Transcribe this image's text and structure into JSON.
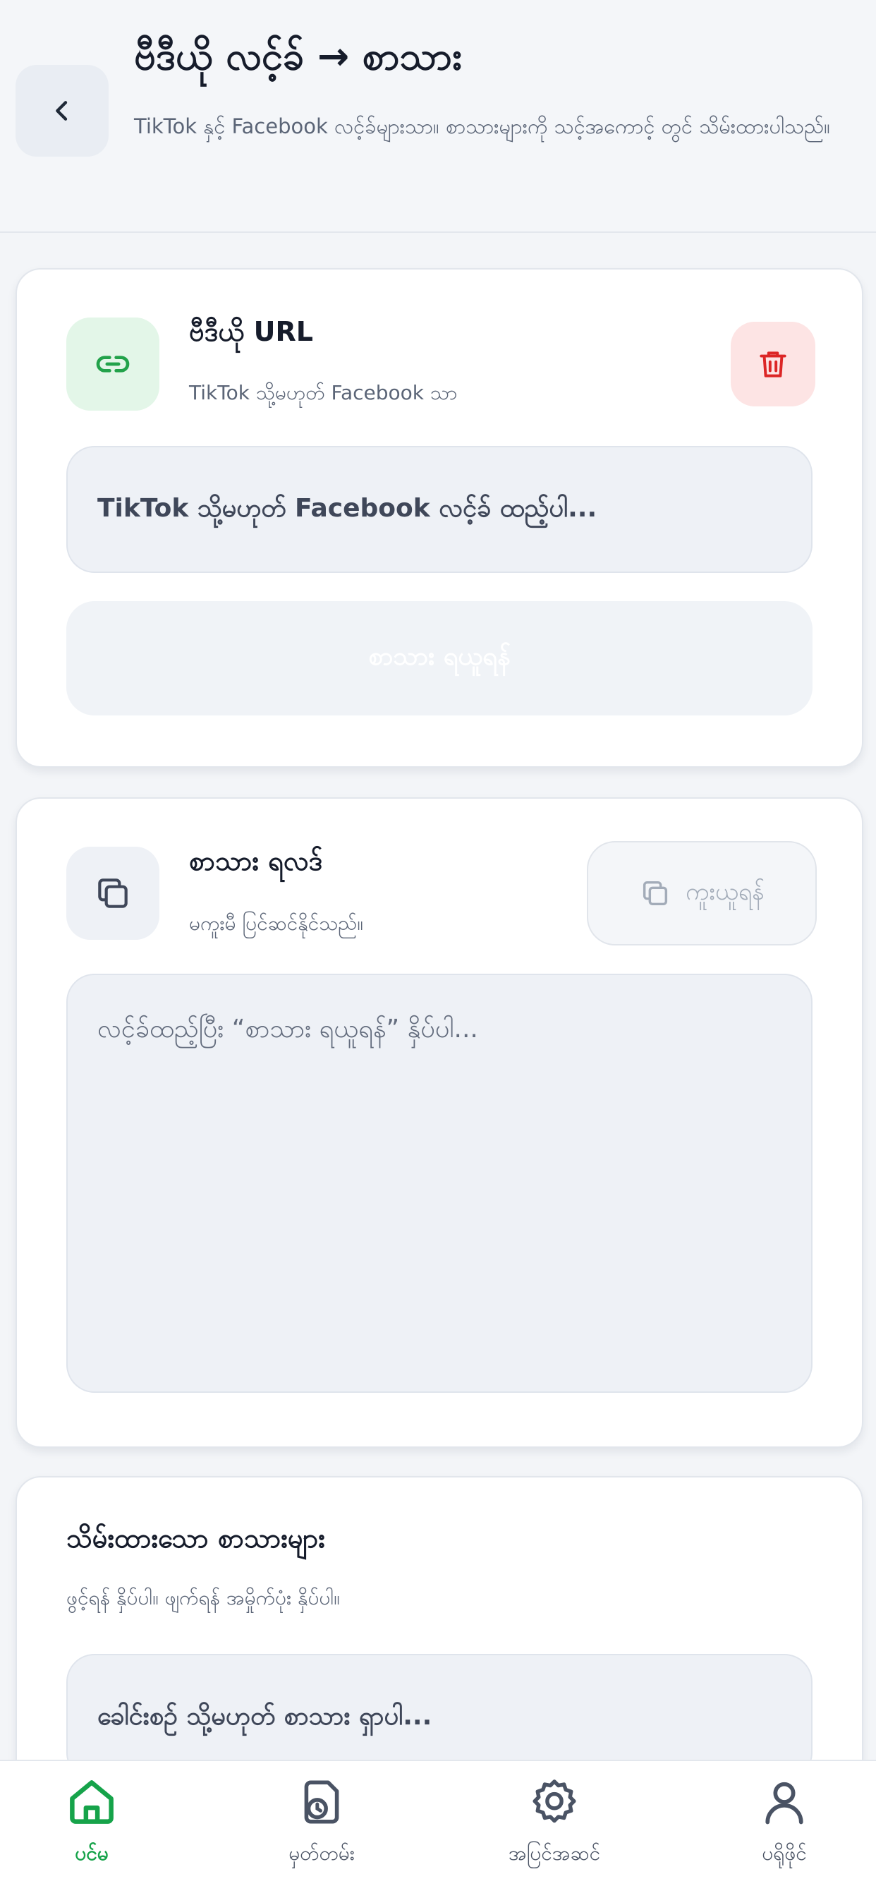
{
  "header": {
    "title": "ဗီဒီယို လင့်ခ် → စာသား",
    "subtitle": "TikTok နှင့် Facebook လင့်ခ်များသာ။ စာသားများကို သင့်အကောင့် တွင် သိမ်းထားပါသည်။"
  },
  "url_card": {
    "title": "ဗီဒီယို URL",
    "subtitle": "TikTok သို့မဟုတ် Facebook သာ",
    "input_placeholder": "TikTok သို့မဟုတ် Facebook လင့်ခ် ထည့်ပါ...",
    "submit_label": "စာသား ရယူရန်"
  },
  "result_card": {
    "title": "စာသား ရလဒ်",
    "subtitle": "မကူးမီ ပြင်ဆင်နိုင်သည်။",
    "copy_label": "ကူးယူရန်",
    "placeholder": "လင့်ခ်ထည့်ပြီး “စာသား ရယူရန်” နှိပ်ပါ..."
  },
  "saved_card": {
    "title": "သိမ်းထားသော စာသားများ",
    "subtitle": "ဖွင့်ရန် နှိပ်ပါ။ ဖျက်ရန် အမှိုက်ပုံး နှိပ်ပါ။",
    "search_placeholder": "ခေါင်းစဉ် သို့မဟုတ် စာသား ရှာပါ..."
  },
  "nav": [
    {
      "label": "ပင်မ",
      "icon": "home-icon",
      "active": true
    },
    {
      "label": "မှတ်တမ်း",
      "icon": "history-icon",
      "active": false
    },
    {
      "label": "အပြင်အဆင်",
      "icon": "settings-gear-icon",
      "active": false
    },
    {
      "label": "ပရိုဖိုင်",
      "icon": "profile-icon",
      "active": false
    }
  ],
  "colors": {
    "accent_green": "#16a34a",
    "danger_red": "#dc2626",
    "background": "#f3f5f8"
  }
}
